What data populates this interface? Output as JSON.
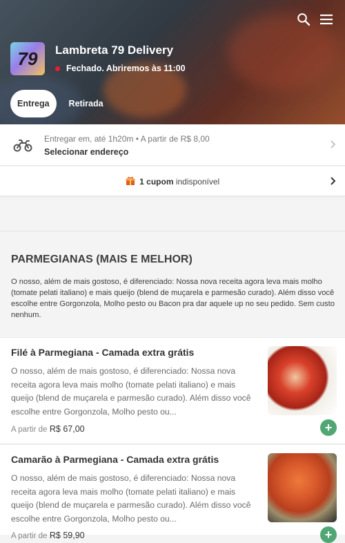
{
  "store": {
    "name": "Lambreta 79 Delivery",
    "logo_text": "79",
    "status_text": "Fechado. Abriremos às 11:00"
  },
  "header": {
    "search_icon": "search-icon",
    "menu_icon": "hamburger-menu-icon"
  },
  "tabs": [
    {
      "label": "Entrega",
      "active": true
    },
    {
      "label": "Retirada",
      "active": false
    }
  ],
  "delivery": {
    "info": "Entregar em, até 1h20m  •  A partir de R$ 8,00",
    "address_label": "Selecionar endereço",
    "icon": "motorcycle-icon"
  },
  "coupon": {
    "count_label": "1 cupom",
    "status_label": "indisponível",
    "icon": "gift-icon"
  },
  "section": {
    "title": "PARMEGIANAS (MAIS E MELHOR)",
    "description": "O nosso, além de mais gostoso, é diferenciado: Nossa nova receita agora leva mais molho (tomate pelati italiano) e mais queijo (blend de muçarela e parmesão curado). Além disso você escolhe entre Gorgonzola, Molho pesto ou Bacon pra dar aquele up no seu pedido. Sem custo nenhum."
  },
  "items": [
    {
      "name": "Filé à Parmegiana - Camada extra grátis",
      "description": "O nosso, além de mais gostoso, é diferenciado: Nossa nova receita agora leva mais molho (tomate pelati italiano) e mais queijo (blend de muçarela e parmesão curado). Além disso você escolhe entre Gorgonzola, Molho pesto ou...",
      "price_prefix": "A partir de",
      "price": "R$ 67,00"
    },
    {
      "name": "Camarão à Parmegiana - Camada extra grátis",
      "description": "O nosso, além de mais gostoso, é diferenciado: Nossa nova receita agora leva mais molho (tomate pelati italiano) e mais queijo (blend de muçarela e parmesão curado). Além disso você escolhe entre Gorgonzola, Molho pesto ou...",
      "price_prefix": "A partir de",
      "price": "R$ 59,90"
    }
  ],
  "add_button_label": "+",
  "colors": {
    "accent_red": "#ea1d2c",
    "add_green": "#50a773"
  }
}
